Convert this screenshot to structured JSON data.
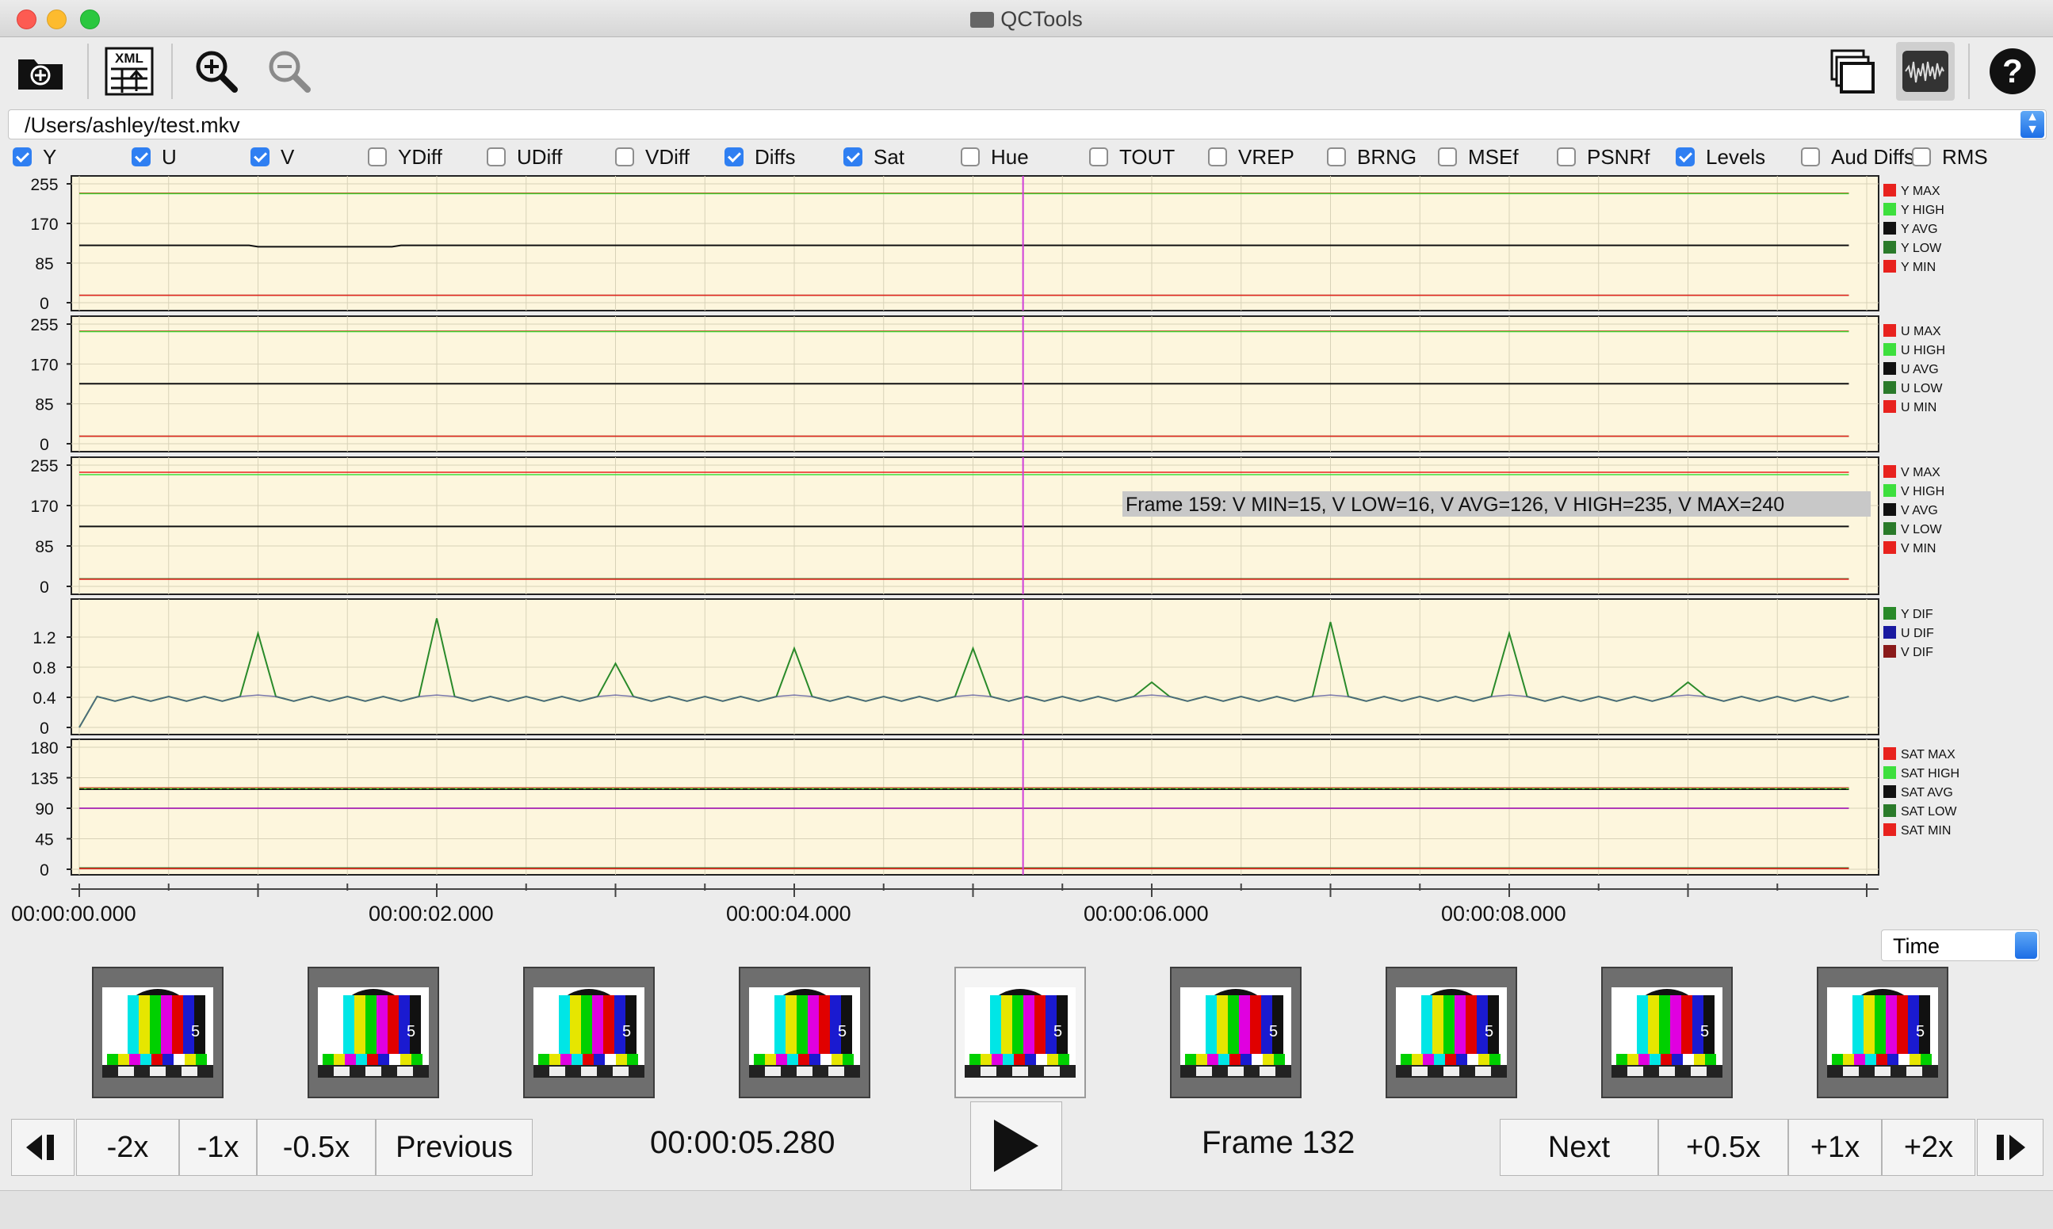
{
  "window": {
    "title": "QCTools"
  },
  "toolbar": {
    "open": "open-file",
    "xml": "XML",
    "zoom_in": "zoom-in",
    "zoom_out": "zoom-out",
    "window": "window",
    "audio": "audio-waveform",
    "help": "help"
  },
  "file": {
    "path": "/Users/ashley/test.mkv"
  },
  "checkboxes": [
    {
      "label": "Y",
      "checked": true
    },
    {
      "label": "U",
      "checked": true
    },
    {
      "label": "V",
      "checked": true
    },
    {
      "label": "YDiff",
      "checked": false
    },
    {
      "label": "UDiff",
      "checked": false
    },
    {
      "label": "VDiff",
      "checked": false
    },
    {
      "label": "Diffs",
      "checked": true
    },
    {
      "label": "Sat",
      "checked": true
    },
    {
      "label": "Hue",
      "checked": false
    },
    {
      "label": "TOUT",
      "checked": false
    },
    {
      "label": "VREP",
      "checked": false
    },
    {
      "label": "BRNG",
      "checked": false
    },
    {
      "label": "MSEf",
      "checked": false
    },
    {
      "label": "PSNRf",
      "checked": false
    },
    {
      "label": "Levels",
      "checked": true
    },
    {
      "label": "Aud Diffs",
      "checked": false
    },
    {
      "label": "RMS",
      "checked": false
    }
  ],
  "plots": [
    {
      "name": "Y",
      "ticks": [
        "255",
        "170",
        "85",
        "0"
      ],
      "tick_values": [
        255,
        170,
        85,
        0
      ],
      "ymax": 255,
      "legend": [
        {
          "label": "Y MAX",
          "color": "#e8221e"
        },
        {
          "label": "Y HIGH",
          "color": "#3ddf3d"
        },
        {
          "label": "Y AVG",
          "color": "#111111"
        },
        {
          "label": "Y LOW",
          "color": "#2a7a2a"
        },
        {
          "label": "Y MIN",
          "color": "#e8221e"
        }
      ]
    },
    {
      "name": "U",
      "ticks": [
        "255",
        "170",
        "85",
        "0"
      ],
      "tick_values": [
        255,
        170,
        85,
        0
      ],
      "ymax": 255,
      "legend": [
        {
          "label": "U MAX",
          "color": "#e8221e"
        },
        {
          "label": "U HIGH",
          "color": "#3ddf3d"
        },
        {
          "label": "U AVG",
          "color": "#111111"
        },
        {
          "label": "U LOW",
          "color": "#2a7a2a"
        },
        {
          "label": "U MIN",
          "color": "#e8221e"
        }
      ]
    },
    {
      "name": "V",
      "ticks": [
        "255",
        "170",
        "85",
        "0"
      ],
      "tick_values": [
        255,
        170,
        85,
        0
      ],
      "ymax": 255,
      "legend": [
        {
          "label": "V MAX",
          "color": "#e8221e"
        },
        {
          "label": "V HIGH",
          "color": "#3ddf3d"
        },
        {
          "label": "V AVG",
          "color": "#111111"
        },
        {
          "label": "V LOW",
          "color": "#2a7a2a"
        },
        {
          "label": "V MIN",
          "color": "#e8221e"
        }
      ],
      "tooltip": "Frame 159: V MIN=15, V LOW=16, V AVG=126, V HIGH=235, V MAX=240"
    },
    {
      "name": "Diffs",
      "ticks": [
        "1.2",
        "0.8",
        "0.4",
        "0"
      ],
      "tick_values": [
        1.2,
        0.8,
        0.4,
        0
      ],
      "ymax": 1.6,
      "legend": [
        {
          "label": "Y DIF",
          "color": "#2a8a2a"
        },
        {
          "label": "U DIF",
          "color": "#1a1aa0"
        },
        {
          "label": "V DIF",
          "color": "#8a1a1a"
        }
      ]
    },
    {
      "name": "Sat",
      "ticks": [
        "180",
        "135",
        "90",
        "45",
        "0"
      ],
      "tick_values": [
        180,
        135,
        90,
        45,
        0
      ],
      "ymax": 180,
      "legend": [
        {
          "label": "SAT MAX",
          "color": "#e8221e"
        },
        {
          "label": "SAT HIGH",
          "color": "#3ddf3d"
        },
        {
          "label": "SAT AVG",
          "color": "#111111"
        },
        {
          "label": "SAT LOW",
          "color": "#2a7a2a"
        },
        {
          "label": "SAT MIN",
          "color": "#e8221e"
        }
      ]
    }
  ],
  "chart_data": {
    "type": "line",
    "x_unit": "seconds",
    "xlim": [
      0,
      10
    ],
    "cursor_time": 5.28,
    "series_data": {
      "Y": {
        "MAX": 235,
        "HIGH": 234,
        "AVG": 120,
        "LOW": 16,
        "MIN": 16
      },
      "U": {
        "MAX": 240,
        "HIGH": 239,
        "AVG": 128,
        "LOW": 16,
        "MIN": 16
      },
      "V": {
        "MAX": 240,
        "HIGH": 235,
        "AVG": 126,
        "LOW": 16,
        "MIN": 15
      },
      "Diffs_baseline": 0.38,
      "Diffs_spikes": [
        {
          "t": 1.0,
          "v": 1.25
        },
        {
          "t": 2.0,
          "v": 1.45
        },
        {
          "t": 3.0,
          "v": 0.85
        },
        {
          "t": 4.0,
          "v": 1.05
        },
        {
          "t": 5.0,
          "v": 1.05
        },
        {
          "t": 6.0,
          "v": 0.6
        },
        {
          "t": 7.0,
          "v": 1.4
        },
        {
          "t": 8.0,
          "v": 1.25
        },
        {
          "t": 9.0,
          "v": 0.6
        }
      ],
      "Sat": {
        "MAX": 120,
        "HIGH": 119,
        "AVG": 118,
        "LOW": 2,
        "MIN": 1,
        "ref": 90
      }
    }
  },
  "time_labels": [
    "00:00:00.000",
    "00:00:02.000",
    "00:00:04.000",
    "00:00:06.000",
    "00:00:08.000"
  ],
  "time_select": "Time",
  "controls": {
    "prev_frame": "prev-frame",
    "m2x": "-2x",
    "m1x": "-1x",
    "m05x": "-0.5x",
    "previous": "Previous",
    "timecode": "00:00:05.280",
    "play": "play",
    "frame": "Frame 132",
    "next": "Next",
    "p05x": "+0.5x",
    "p1x": "+1x",
    "p2x": "+2x",
    "next_frame": "next-frame"
  },
  "thumbnails_count": 9,
  "selected_thumbnail": 4
}
